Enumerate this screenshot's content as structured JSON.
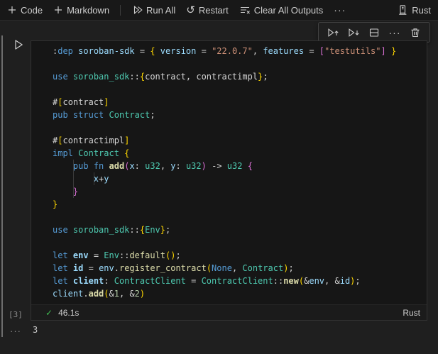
{
  "colors": {
    "kw": "#569cd6",
    "var": "#9cdcfe",
    "type": "#4ec9b0",
    "fn": "#dcdcaa",
    "str": "#ce9178",
    "num": "#b5cea8",
    "fg": "#d4d4d4",
    "b1": "#ffd700",
    "b2": "#da70d6",
    "success_green": "#3fb950"
  },
  "toolbar": {
    "code_label": "Code",
    "markdown_label": "Markdown",
    "run_all_label": "Run All",
    "restart_label": "Restart",
    "clear_outputs_label": "Clear All Outputs",
    "more_icon": "···",
    "kernel_label": "Rust"
  },
  "cell_toolbar": {
    "more_icon": "···"
  },
  "cell": {
    "execution_count": "[3]",
    "status": {
      "duration": "46.1s",
      "check_icon": "✓",
      "language": "Rust"
    },
    "code_lines": [
      [
        [
          ":",
          "fg"
        ],
        [
          "dep",
          "kw"
        ],
        [
          " ",
          "fg"
        ],
        [
          "soroban-sdk",
          "var"
        ],
        [
          " = ",
          "fg"
        ],
        [
          "{",
          "b1"
        ],
        [
          " ",
          "fg"
        ],
        [
          "version",
          "var"
        ],
        [
          " = ",
          "fg"
        ],
        [
          "\"22.0.7\"",
          "str"
        ],
        [
          ", ",
          "fg"
        ],
        [
          "features",
          "var"
        ],
        [
          " = ",
          "fg"
        ],
        [
          "[",
          "b2"
        ],
        [
          "\"testutils\"",
          "str"
        ],
        [
          "]",
          "b2"
        ],
        [
          " ",
          "fg"
        ],
        [
          "}",
          "b1"
        ]
      ],
      [],
      [
        [
          "use",
          "kw"
        ],
        [
          " ",
          "fg"
        ],
        [
          "soroban_sdk",
          "type"
        ],
        [
          "::",
          "fg"
        ],
        [
          "{",
          "b1"
        ],
        [
          "contract",
          "fg"
        ],
        [
          ", ",
          "fg"
        ],
        [
          "contractimpl",
          "fg"
        ],
        [
          "}",
          "b1"
        ],
        [
          ";",
          "fg"
        ]
      ],
      [],
      [
        [
          "#",
          "fg"
        ],
        [
          "[",
          "b1"
        ],
        [
          "contract",
          "fg"
        ],
        [
          "]",
          "b1"
        ]
      ],
      [
        [
          "pub",
          "kw"
        ],
        [
          " ",
          "fg"
        ],
        [
          "struct",
          "kw"
        ],
        [
          " ",
          "fg"
        ],
        [
          "Contract",
          "type"
        ],
        [
          ";",
          "fg"
        ]
      ],
      [],
      [
        [
          "#",
          "fg"
        ],
        [
          "[",
          "b1"
        ],
        [
          "contractimpl",
          "fg"
        ],
        [
          "]",
          "b1"
        ]
      ],
      [
        [
          "impl",
          "kw"
        ],
        [
          " ",
          "fg"
        ],
        [
          "Contract",
          "type"
        ],
        [
          " ",
          "fg"
        ],
        [
          "{",
          "b1"
        ]
      ],
      [
        [
          "    ",
          "fg"
        ],
        [
          "pub",
          "kw"
        ],
        [
          " ",
          "fg"
        ],
        [
          "fn",
          "kw"
        ],
        [
          " ",
          "fg"
        ],
        [
          "add",
          "fn",
          true
        ],
        [
          "(",
          "b2"
        ],
        [
          "x",
          "var"
        ],
        [
          ": ",
          "fg"
        ],
        [
          "u32",
          "type"
        ],
        [
          ", ",
          "fg"
        ],
        [
          "y",
          "var"
        ],
        [
          ": ",
          "fg"
        ],
        [
          "u32",
          "type"
        ],
        [
          ")",
          "b2"
        ],
        [
          " -> ",
          "fg"
        ],
        [
          "u32",
          "type"
        ],
        [
          " ",
          "fg"
        ],
        [
          "{",
          "b2"
        ]
      ],
      [
        [
          "        ",
          "fg"
        ],
        [
          "x",
          "var"
        ],
        [
          "+",
          "fg"
        ],
        [
          "y",
          "var"
        ]
      ],
      [
        [
          "    ",
          "fg"
        ],
        [
          "}",
          "b2"
        ]
      ],
      [
        [
          "}",
          "b1"
        ]
      ],
      [],
      [
        [
          "use",
          "kw"
        ],
        [
          " ",
          "fg"
        ],
        [
          "soroban_sdk",
          "type"
        ],
        [
          "::",
          "fg"
        ],
        [
          "{",
          "b1"
        ],
        [
          "Env",
          "type"
        ],
        [
          "}",
          "b1"
        ],
        [
          ";",
          "fg"
        ]
      ],
      [],
      [
        [
          "let",
          "kw"
        ],
        [
          " ",
          "fg"
        ],
        [
          "env",
          "var",
          true
        ],
        [
          " = ",
          "fg"
        ],
        [
          "Env",
          "type"
        ],
        [
          "::",
          "fg"
        ],
        [
          "default",
          "fn"
        ],
        [
          "(",
          "b1"
        ],
        [
          ")",
          "b1"
        ],
        [
          ";",
          "fg"
        ]
      ],
      [
        [
          "let",
          "kw"
        ],
        [
          " ",
          "fg"
        ],
        [
          "id",
          "var",
          true
        ],
        [
          " = ",
          "fg"
        ],
        [
          "env",
          "var"
        ],
        [
          ".",
          "fg"
        ],
        [
          "register_contract",
          "fn"
        ],
        [
          "(",
          "b1"
        ],
        [
          "None",
          "kw"
        ],
        [
          ", ",
          "fg"
        ],
        [
          "Contract",
          "type"
        ],
        [
          ")",
          "b1"
        ],
        [
          ";",
          "fg"
        ]
      ],
      [
        [
          "let",
          "kw"
        ],
        [
          " ",
          "fg"
        ],
        [
          "client",
          "var",
          true
        ],
        [
          ": ",
          "fg"
        ],
        [
          "ContractClient",
          "type"
        ],
        [
          " = ",
          "fg"
        ],
        [
          "ContractClient",
          "type"
        ],
        [
          "::",
          "fg"
        ],
        [
          "new",
          "fn",
          true
        ],
        [
          "(",
          "b1"
        ],
        [
          "&",
          "fg"
        ],
        [
          "env",
          "var"
        ],
        [
          ", ",
          "fg"
        ],
        [
          "&",
          "fg"
        ],
        [
          "id",
          "var"
        ],
        [
          ")",
          "b1"
        ],
        [
          ";",
          "fg"
        ]
      ],
      [
        [
          "client",
          "var"
        ],
        [
          ".",
          "fg"
        ],
        [
          "add",
          "fn",
          true
        ],
        [
          "(",
          "b1"
        ],
        [
          "&",
          "fg"
        ],
        [
          "1",
          "num"
        ],
        [
          ", ",
          "fg"
        ],
        [
          "&",
          "fg"
        ],
        [
          "2",
          "num"
        ],
        [
          ")",
          "b1"
        ]
      ]
    ]
  },
  "output": {
    "collapse_icon": "···",
    "value": "3"
  }
}
